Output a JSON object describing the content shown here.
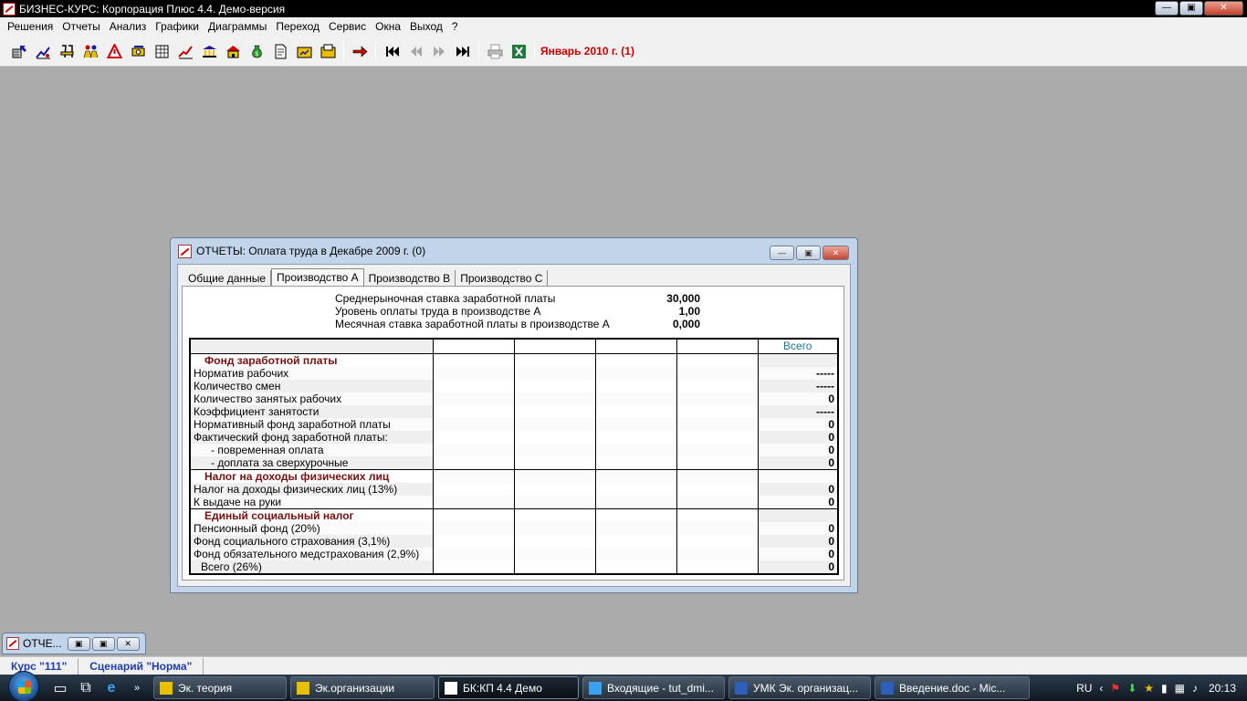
{
  "app": {
    "title": "БИЗНЕС-КУРС: Корпорация Плюс 4.4. Демо-версия",
    "minimize": "—",
    "maximize": "▣",
    "close": "✕"
  },
  "menu": [
    "Решения",
    "Отчеты",
    "Анализ",
    "Графики",
    "Диаграммы",
    "Переход",
    "Сервис",
    "Окна",
    "Выход",
    "?"
  ],
  "toolbar": {
    "period_label": "Январь 2010 г. (1)",
    "colors": {
      "period": "#d40000"
    }
  },
  "report_window": {
    "title": "ОТЧЕТЫ: Оплата труда в Декабре 2009 г. (0)",
    "tabs": [
      "Общие данные",
      "Производство А",
      "Производство В",
      "Производство С"
    ],
    "active_tab": "Производство А",
    "params": [
      {
        "label": "Среднерыночная ставка заработной платы",
        "value": "30,000"
      },
      {
        "label": "Уровень оплаты труда в производстве А",
        "value": "1,00"
      },
      {
        "label": "Месячная ставка заработной платы в производстве А",
        "value": "0,000"
      }
    ],
    "table": {
      "total_header": "Всего",
      "rows": [
        {
          "label": "Фонд заработной платы",
          "kind": "section",
          "total": ""
        },
        {
          "label": "Норматив рабочих",
          "kind": "row",
          "total": "-----"
        },
        {
          "label": "Количество смен",
          "kind": "row",
          "total": "-----"
        },
        {
          "label": "Количество занятых рабочих",
          "kind": "row",
          "total": "0"
        },
        {
          "label": "Коэффициент занятости",
          "kind": "row",
          "total": "-----"
        },
        {
          "label": "Нормативный фонд заработной платы",
          "kind": "row",
          "total": "0"
        },
        {
          "label": "Фактический фонд заработной платы:",
          "kind": "row",
          "total": "0"
        },
        {
          "label": "- повременная оплата",
          "kind": "indent",
          "total": "0"
        },
        {
          "label": "- доплата за сверхурочные",
          "kind": "indent",
          "total": "0"
        },
        {
          "label": "Налог на доходы физических лиц",
          "kind": "section",
          "total": ""
        },
        {
          "label": "Налог на доходы физических лиц (13%)",
          "kind": "row",
          "total": "0"
        },
        {
          "label": "К выдаче на руки",
          "kind": "row",
          "total": "0"
        },
        {
          "label": "Единый социальный налог",
          "kind": "section",
          "total": ""
        },
        {
          "label": "Пенсионный фонд (20%)",
          "kind": "row",
          "total": "0"
        },
        {
          "label": "Фонд социального страхования (3,1%)",
          "kind": "row",
          "total": "0"
        },
        {
          "label": "Фонд обязательного медстрахования (2,9%)",
          "kind": "row",
          "total": "0"
        },
        {
          "label": "Всего (26%)",
          "kind": "sub",
          "total": "0"
        }
      ]
    }
  },
  "minimized_window": {
    "title": "ОТЧЕ..."
  },
  "status": {
    "course": "Курс \"111\"",
    "scenario": "Сценарий \"Норма\""
  },
  "taskbar": {
    "items": [
      {
        "label": "Эк. теория",
        "active": false
      },
      {
        "label": "Эк.организации",
        "active": false
      },
      {
        "label": "БК:КП 4.4 Демо",
        "active": true
      },
      {
        "label": "Входящие - tut_dmi...",
        "active": false
      },
      {
        "label": "УМК Эк. организац...",
        "active": false
      },
      {
        "label": "Введение.doc - Mic...",
        "active": false
      }
    ],
    "language": "RU",
    "clock": "20:13"
  }
}
